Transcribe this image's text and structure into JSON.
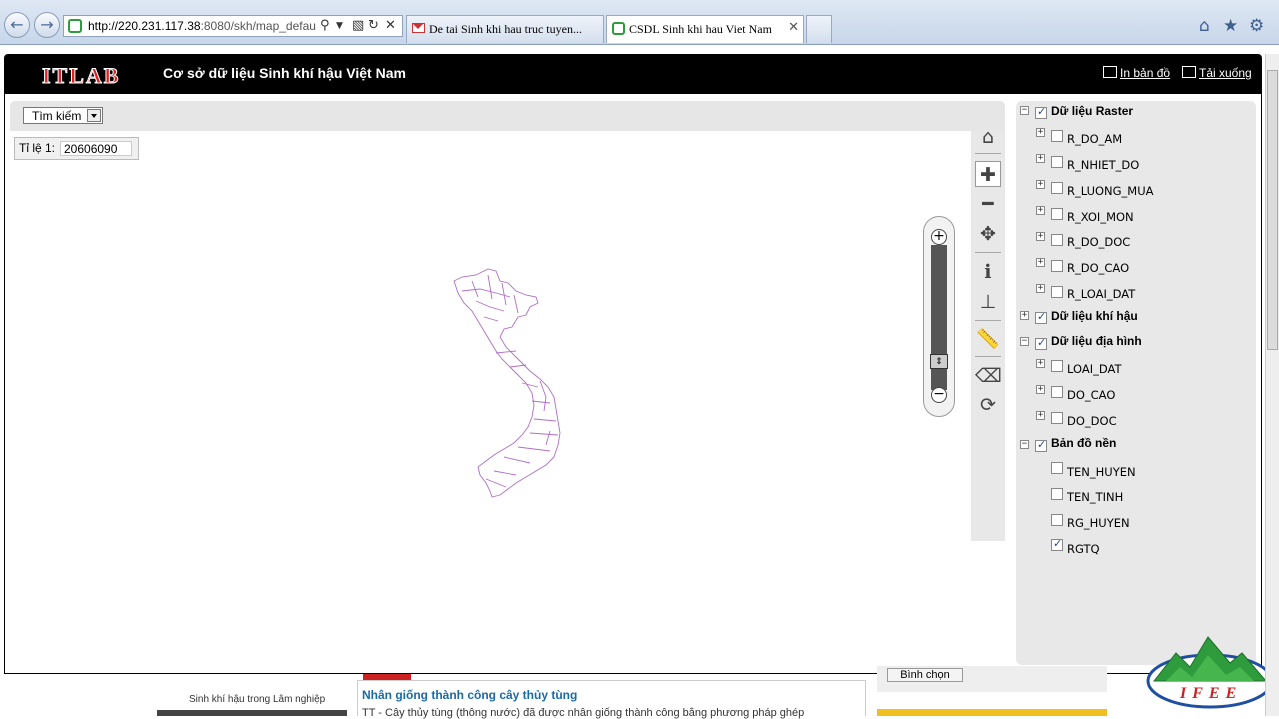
{
  "browser": {
    "address_url_host": "http://220.231.117.38",
    "address_url_rest": ":8080/skh/map_defau",
    "tabs": [
      {
        "title": "De tai Sinh khi hau truc tuyen..."
      },
      {
        "title": "CSDL Sinh khi hau Viet Nam"
      }
    ]
  },
  "header": {
    "logo_text": "ITLAB",
    "site_title": "Cơ sở dữ liệu Sinh khí hậu Việt Nam",
    "print_label": "In bản đồ",
    "download_label": "Tải xuống"
  },
  "map": {
    "search_label": "Tìm kiếm",
    "scale_label": "Tỉ lệ 1:",
    "scale_value": "20606090"
  },
  "layers": {
    "groups": [
      {
        "label": "Dữ liệu Raster",
        "checked": true,
        "expanded": true,
        "items": [
          {
            "label": "R_DO_AM",
            "checked": false
          },
          {
            "label": "R_NHIET_DO",
            "checked": false
          },
          {
            "label": "R_LUONG_MUA",
            "checked": false
          },
          {
            "label": "R_XOI_MON",
            "checked": false
          },
          {
            "label": "R_DO_DOC",
            "checked": false
          },
          {
            "label": "R_DO_CAO",
            "checked": false
          },
          {
            "label": "R_LOAI_DAT",
            "checked": false
          }
        ]
      },
      {
        "label": "Dữ liệu khí hậu",
        "checked": true,
        "expanded": false,
        "items": []
      },
      {
        "label": "Dữ liệu địa hình",
        "checked": true,
        "expanded": true,
        "items": [
          {
            "label": "LOAI_DAT",
            "checked": false
          },
          {
            "label": "DO_CAO",
            "checked": false
          },
          {
            "label": "DO_DOC",
            "checked": false
          }
        ]
      },
      {
        "label": "Bản đồ nền",
        "checked": true,
        "expanded": true,
        "items": [
          {
            "label": "TEN_HUYEN",
            "checked": false
          },
          {
            "label": "TEN_TINH",
            "checked": false
          },
          {
            "label": "RG_HUYEN",
            "checked": false
          },
          {
            "label": "RGTQ",
            "checked": true
          }
        ]
      }
    ]
  },
  "page_below": {
    "image_caption": "Sinh khí hậu trong Lâm nghiệp",
    "news_title": "Nhân giống thành công cây thủy tùng",
    "news_snippet": "TT - Cây thủy tùng (thông nước) đã được nhân giống thành công bằng phương pháp ghép",
    "poll_button": "Bình chọn",
    "logo_text": "IFEE"
  }
}
